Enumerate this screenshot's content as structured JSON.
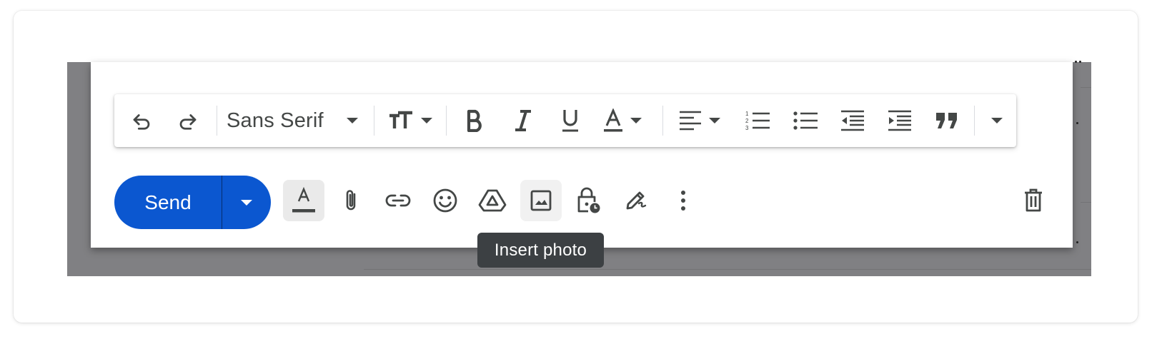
{
  "format_bar": {
    "undo_icon": "undo-icon",
    "redo_icon": "redo-icon",
    "font_family": "Sans Serif",
    "items": [
      "font-size-icon",
      "bold-icon",
      "italic-icon",
      "underline-icon",
      "text-color-icon",
      "align-icon",
      "numbered-list-icon",
      "bulleted-list-icon",
      "indent-less-icon",
      "indent-more-icon",
      "quote-icon",
      "more-formatting-icon"
    ]
  },
  "send": {
    "label": "Send",
    "more_icon": "chevron-down-icon"
  },
  "actions": [
    "formatting-options-icon",
    "attach-icon",
    "link-icon",
    "emoji-icon",
    "drive-icon",
    "insert-photo-icon",
    "confidential-mode-icon",
    "signature-icon",
    "more-options-icon",
    "discard-icon"
  ],
  "tooltip": {
    "text": "Insert photo"
  },
  "colors": {
    "send_blue": "#0b57d0",
    "icon_gray": "#444746",
    "tooltip_bg": "#3c4043",
    "overlay": "#808083"
  }
}
